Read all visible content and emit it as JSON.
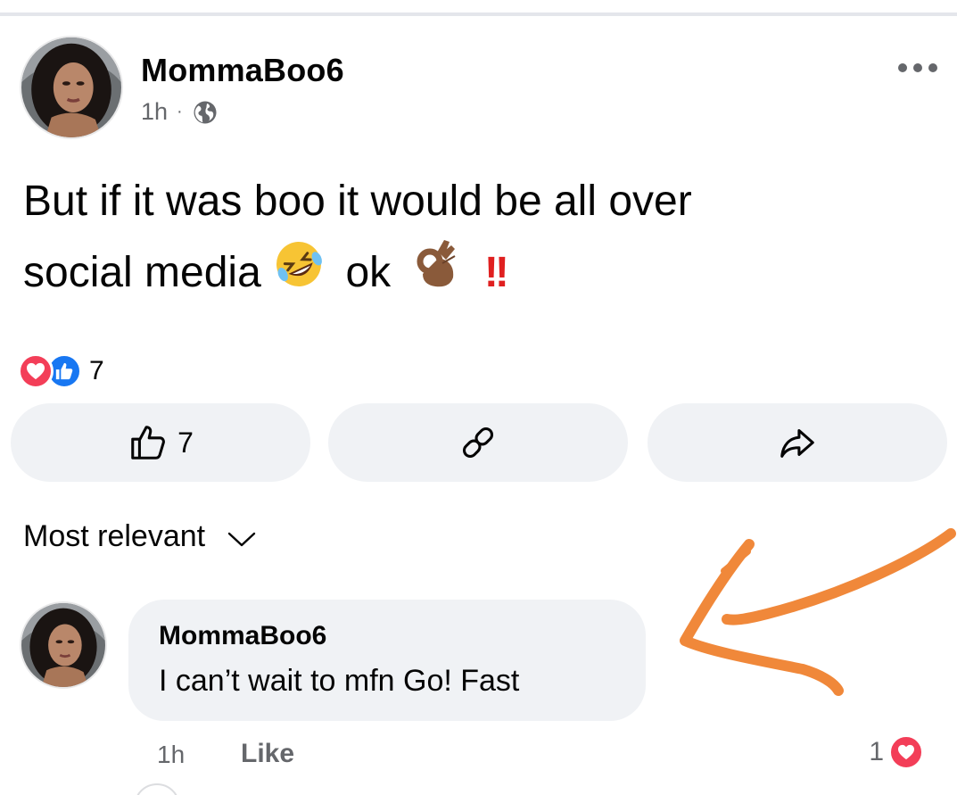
{
  "post": {
    "author": "MommaBoo6",
    "time": "1h",
    "separator": "·",
    "privacy_icon": "globe-icon",
    "text_line1": "But if it was boo it would be all over",
    "text_line2_a": "social media",
    "text_line2_b": "ok",
    "text_line2_c": "!!",
    "emojis": [
      "rolling-on-floor-laughing",
      "ok-hand-medium-dark-skin"
    ],
    "reaction_count": "7",
    "reaction_types": [
      "heart",
      "like"
    ]
  },
  "actions": {
    "like_count": "7",
    "like_icon": "thumbs-up-icon",
    "link_icon": "link-icon",
    "share_icon": "share-icon"
  },
  "comments": {
    "sort_label": "Most relevant",
    "items": [
      {
        "author": "MommaBoo6",
        "text": "I can’t wait to mfn Go! Fast",
        "time": "1h",
        "like_label": "Like",
        "reaction_count": "1",
        "reaction_type": "heart"
      }
    ]
  },
  "colors": {
    "accent_blue": "#1877f2",
    "heart_red": "#f33e58",
    "secondary_text": "#65676b",
    "button_bg": "#f0f2f5",
    "annotation_orange": "#f0883a",
    "bang_red": "#e02020"
  }
}
